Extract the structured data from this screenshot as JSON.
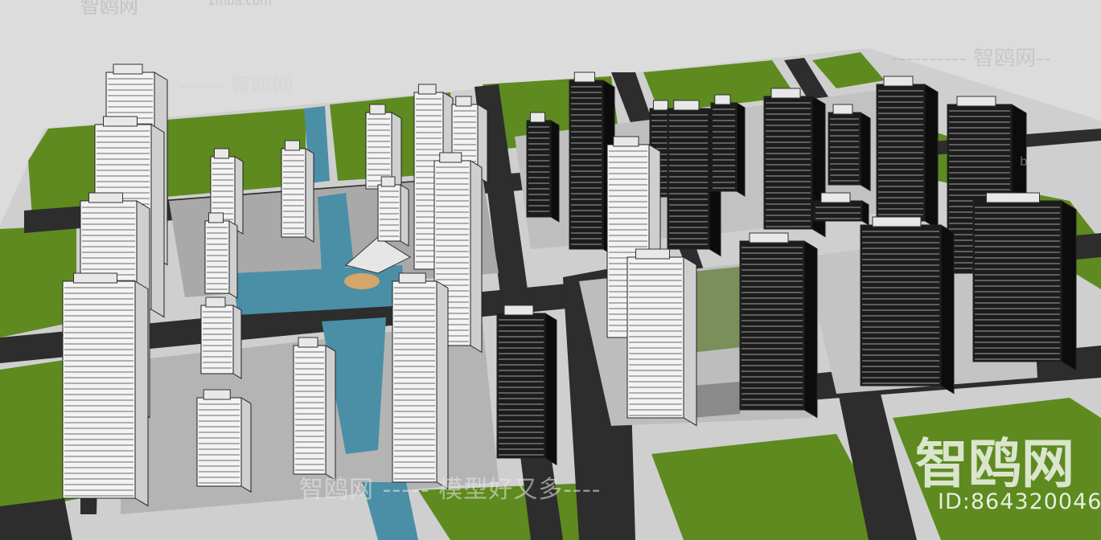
{
  "watermarks": {
    "top_left": "智鸥网",
    "top_url": "1mba.com",
    "upper": "------ 智鸥网",
    "right": "---------- 智鸥网--",
    "right_url": "ba.com",
    "center": "智鸥网 ----- 模型好又多----",
    "brand_big": "智鸥网",
    "id_text": "ID:864320046"
  },
  "colors": {
    "background": "#dcdcdc",
    "ground": "#cfcfcf",
    "grass": "#5e8a1f",
    "road": "#2d2d2d",
    "plaza": "#b9b9b9",
    "water": "#4a8fa6",
    "tower_light": "#f4f4f4",
    "tower_dark": "#1a1a1a"
  }
}
